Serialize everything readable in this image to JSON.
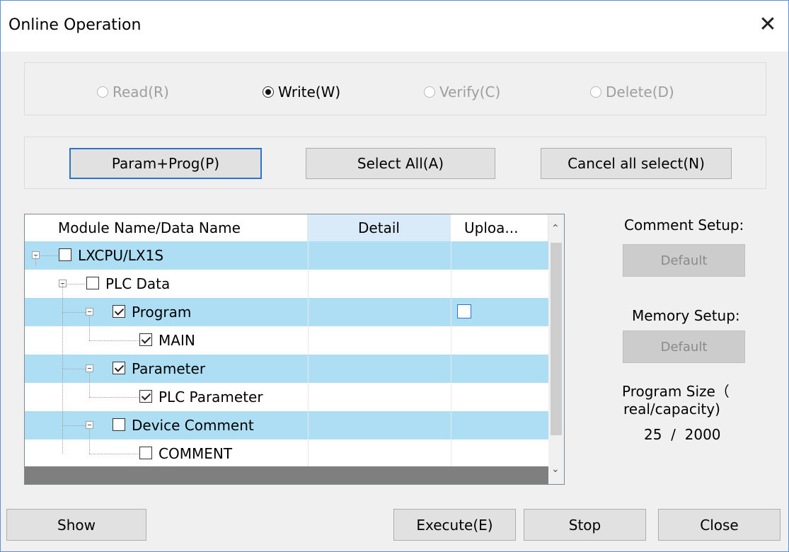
{
  "window": {
    "title": "Online Operation",
    "close_glyph": "✕"
  },
  "mode": {
    "read": "Read(R)",
    "write": "Write(W)",
    "verify": "Verify(C)",
    "delete": "Delete(D)",
    "selected": "write"
  },
  "selection_buttons": {
    "param_prog": "Param+Prog(P)",
    "select_all": "Select All(A)",
    "cancel_all": "Cancel all select(N)"
  },
  "tree": {
    "columns": [
      "Module Name/Data Name",
      "Detail",
      "Uploa..."
    ],
    "rows": [
      {
        "label": "LXCPU/LX1S",
        "checked": false,
        "highlight": true
      },
      {
        "label": "PLC Data",
        "checked": false,
        "highlight": false
      },
      {
        "label": "Program",
        "checked": true,
        "highlight": true,
        "upload_checkbox": true
      },
      {
        "label": "MAIN",
        "checked": true,
        "highlight": false
      },
      {
        "label": "Parameter",
        "checked": true,
        "highlight": true
      },
      {
        "label": "PLC Parameter",
        "checked": true,
        "highlight": false
      },
      {
        "label": "Device Comment",
        "checked": false,
        "highlight": true
      },
      {
        "label": "COMMENT",
        "checked": false,
        "highlight": false
      }
    ]
  },
  "side": {
    "comment_setup": "Comment Setup:",
    "comment_default": "Default",
    "memory_setup": "Memory Setup:",
    "memory_default": "Default",
    "program_size_line1": "Program Size（",
    "program_size_line2": "real/capacity)",
    "program_size_value": "25  /  2000"
  },
  "footer": {
    "show": "Show",
    "execute": "Execute(E)",
    "stop": "Stop",
    "close": "Close"
  },
  "colors": {
    "row_highlight": "#aedef4",
    "focus_border": "#2b74c9"
  }
}
